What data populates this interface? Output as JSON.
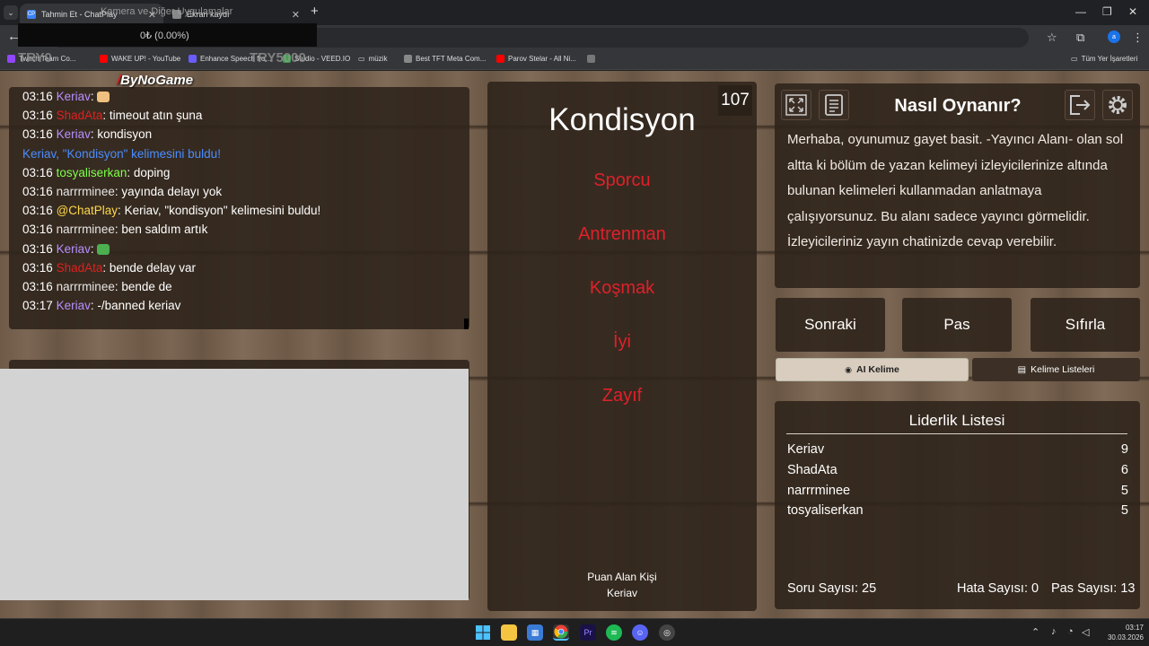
{
  "browser": {
    "tabs": [
      {
        "title": "Tahmin Et - ChatPlay",
        "favicon": "CP",
        "active": true
      },
      {
        "title": "Ekran kaydı",
        "favicon": "",
        "active": false
      }
    ],
    "tab_overlay_text": "Kamera ve Diğer Uygulamalar",
    "bookmarks": [
      {
        "label": "Twitch Team Co...",
        "color": "#9146ff"
      },
      {
        "label": "WAKE UP! - YouTube",
        "color": "#ff0000"
      },
      {
        "label": "Enhance Speech fro...",
        "color": "#6b5cff"
      },
      {
        "label": "Studio - VEED.IO",
        "color": "#3fa34d"
      },
      {
        "label": "müzik",
        "color": "folder"
      },
      {
        "label": "Best TFT Meta Com...",
        "color": "#888888"
      },
      {
        "label": "Parov Stelar - All Ni...",
        "color": "#ff0000"
      },
      {
        "label": "",
        "color": "#777777"
      }
    ],
    "all_bookmarks": "Tüm Yer İşaretleri",
    "profile_initial": "a"
  },
  "stream_overlay": {
    "donation": "0₺ (0.00%)",
    "label_left": "TRY0",
    "label_right": "TRY5000",
    "bynogame": "ByNoGame"
  },
  "chat": [
    {
      "time": "03:16",
      "user": "Keriav",
      "style": "keriav",
      "msg": "",
      "emote": "#f0c080"
    },
    {
      "time": "03:16",
      "user": "ShadAta",
      "style": "red",
      "msg": "timeout atın şuna"
    },
    {
      "time": "03:16",
      "user": "Keriav",
      "style": "keriav",
      "msg": "kondisyon"
    },
    {
      "time": "",
      "user": "",
      "style": "system",
      "msg": "Keriav, \"Kondisyon\" kelimesini buldu!"
    },
    {
      "time": "03:16",
      "user": "tosyaliserkan",
      "style": "green",
      "msg": "doping"
    },
    {
      "time": "03:16",
      "user": "narrrminee",
      "style": "plain",
      "msg": "yayında delayı yok"
    },
    {
      "time": "03:16",
      "user": "@ChatPlay",
      "style": "chatplay",
      "msg": "Keriav, \"kondisyon\" kelimesini buldu!"
    },
    {
      "time": "03:16",
      "user": "narrrminee",
      "style": "plain",
      "msg": "ben saldım artık"
    },
    {
      "time": "03:16",
      "user": "Keriav",
      "style": "keriav",
      "msg": "",
      "emote": "#4caf50"
    },
    {
      "time": "03:16",
      "user": "ShadAta",
      "style": "red",
      "msg": "bende delay var"
    },
    {
      "time": "03:16",
      "user": "narrrminee",
      "style": "plain",
      "msg": "bende de"
    },
    {
      "time": "03:17",
      "user": "Keriav",
      "style": "keriav",
      "msg": "-/banned keriav"
    }
  ],
  "game": {
    "word_count": "107",
    "main_word": "Kondisyon",
    "taboo_words": [
      "Sporcu",
      "Antrenman",
      "Koşmak",
      "İyi",
      "Zayıf"
    ],
    "scorer_label": "Puan Alan Kişi",
    "scorer_name": "Keriav"
  },
  "how_to": {
    "title": "Nasıl Oynanır?",
    "text": "Merhaba, oyunumuz gayet basit. -Yayıncı Alanı- olan sol altta ki bölüm de yazan kelimeyi izleyicilerinize altında bulunan kelimeleri kullanmadan anlatmaya çalışıyorsunuz. Bu alanı sadece yayıncı görmelidir. İzleyicileriniz yayın chatinizde cevap verebilir."
  },
  "actions": {
    "next": "Sonraki",
    "pass": "Pas",
    "reset": "Sıfırla",
    "ai_word": "AI Kelime",
    "word_lists": "Kelime Listeleri"
  },
  "leaderboard": {
    "title": "Liderlik Listesi",
    "rows": [
      {
        "name": "Keriav",
        "score": "9"
      },
      {
        "name": "ShadAta",
        "score": "6"
      },
      {
        "name": "narrrminee",
        "score": "5"
      },
      {
        "name": "tosyaliserkan",
        "score": "5"
      }
    ],
    "question_count": "Soru Sayısı: 25",
    "error_count": "Hata Sayısı: 0",
    "pass_count": "Pas Sayısı: 13"
  },
  "taskbar": {
    "time": "03:17",
    "date": "30.03.2026"
  },
  "colors": {
    "taboo": "#e0202a",
    "keriav": "#b88fff",
    "wood": "#705b49"
  }
}
